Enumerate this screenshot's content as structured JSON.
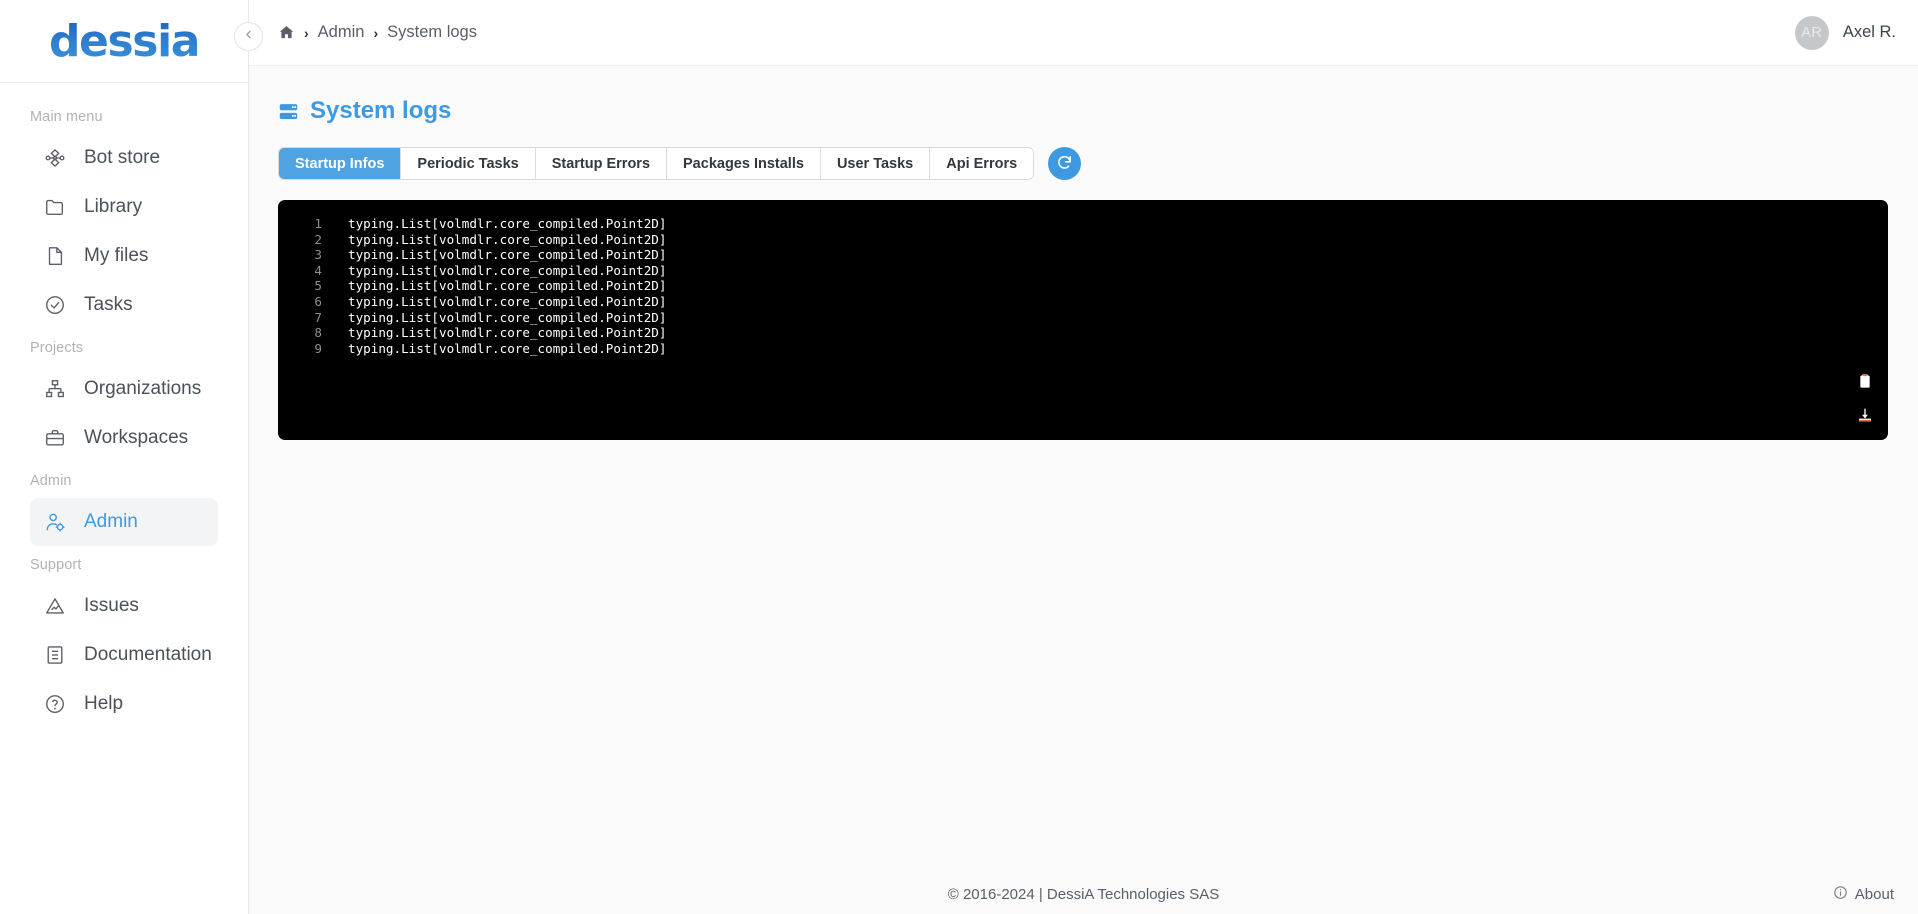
{
  "brand": {
    "logo_text": "dessia"
  },
  "sidebar": {
    "sections": [
      {
        "label": "Main menu",
        "items": [
          {
            "label": "Bot store",
            "icon": "nodes-icon",
            "active": false
          },
          {
            "label": "Library",
            "icon": "folder-icon",
            "active": false
          },
          {
            "label": "My files",
            "icon": "file-icon",
            "active": false
          },
          {
            "label": "Tasks",
            "icon": "check-circle-icon",
            "active": false
          }
        ]
      },
      {
        "label": "Projects",
        "items": [
          {
            "label": "Organizations",
            "icon": "sitemap-icon",
            "active": false
          },
          {
            "label": "Workspaces",
            "icon": "briefcase-icon",
            "active": false
          }
        ]
      },
      {
        "label": "Admin",
        "items": [
          {
            "label": "Admin",
            "icon": "user-gear-icon",
            "active": true
          }
        ]
      },
      {
        "label": "Support",
        "items": [
          {
            "label": "Issues",
            "icon": "warning-triangle-icon",
            "active": false
          },
          {
            "label": "Documentation",
            "icon": "book-icon",
            "active": false
          },
          {
            "label": "Help",
            "icon": "question-circle-icon",
            "active": false
          }
        ]
      }
    ],
    "collapse_icon": "chevron-left-icon"
  },
  "topbar": {
    "breadcrumb": {
      "home_icon": "home-icon",
      "separator": "›",
      "items": [
        "Admin",
        "System logs"
      ]
    },
    "user": {
      "initials": "AR",
      "name": "Axel R."
    }
  },
  "page": {
    "title": "System logs",
    "title_icon": "server-icon",
    "tabs": [
      {
        "label": "Startup Infos",
        "active": true
      },
      {
        "label": "Periodic Tasks",
        "active": false
      },
      {
        "label": "Startup Errors",
        "active": false
      },
      {
        "label": "Packages Installs",
        "active": false
      },
      {
        "label": "User Tasks",
        "active": false
      },
      {
        "label": "Api Errors",
        "active": false
      }
    ],
    "refresh_icon": "refresh-icon",
    "log": {
      "lines": [
        {
          "n": "1",
          "text": "typing.List[volmdlr.core_compiled.Point2D]"
        },
        {
          "n": "2",
          "text": "typing.List[volmdlr.core_compiled.Point2D]"
        },
        {
          "n": "3",
          "text": "typing.List[volmdlr.core_compiled.Point2D]"
        },
        {
          "n": "4",
          "text": "typing.List[volmdlr.core_compiled.Point2D]"
        },
        {
          "n": "5",
          "text": "typing.List[volmdlr.core_compiled.Point2D]"
        },
        {
          "n": "6",
          "text": "typing.List[volmdlr.core_compiled.Point2D]"
        },
        {
          "n": "7",
          "text": "typing.List[volmdlr.core_compiled.Point2D]"
        },
        {
          "n": "8",
          "text": "typing.List[volmdlr.core_compiled.Point2D]"
        },
        {
          "n": "9",
          "text": "typing.List[volmdlr.core_compiled.Point2D]"
        }
      ],
      "actions": [
        {
          "name": "copy-to-clipboard",
          "icon": "clipboard-icon"
        },
        {
          "name": "download-logs",
          "icon": "download-icon"
        }
      ]
    }
  },
  "footer": {
    "copyright": "© 2016-2024 | DessiA Technologies SAS",
    "about_label": "About",
    "about_icon": "info-circle-icon"
  },
  "colors": {
    "brand_blue": "#3d9ae2",
    "tab_active": "#4fa3e3",
    "panel_black": "#000000",
    "page_bg": "#fafafa",
    "text": "#4b5159",
    "muted": "#b2b2b2"
  }
}
